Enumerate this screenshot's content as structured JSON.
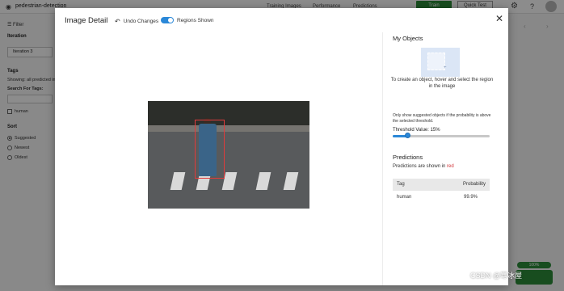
{
  "app": {
    "project_title": "pedestrian-detection",
    "nav": [
      "Training Images",
      "Performance",
      "Predictions"
    ],
    "train_label": "Train",
    "quick_test_label": "Quick Test",
    "accent_color": "#2c8c3a"
  },
  "sidebar": {
    "filter_label": "Filter",
    "iteration_heading": "Iteration",
    "iteration_value": "Iteration 3",
    "tags_heading": "Tags",
    "showing_text": "Showing: all predicted in",
    "search_tags_label": "Search For Tags:",
    "tag_item": "human",
    "sort_heading": "Sort",
    "sort_options": [
      "Suggested",
      "Newest",
      "Oldest"
    ],
    "sort_selected": "Suggested"
  },
  "progress": {
    "value": 1.0,
    "label": "100%"
  },
  "modal": {
    "title": "Image Detail",
    "undo_label": "Undo Changes",
    "regions_toggle_label": "Regions Shown",
    "regions_shown": true,
    "image_alt": "pedestrian crossing street",
    "my_objects": {
      "heading": "My Objects",
      "hint": "To create an object, hover and select the region in the image"
    },
    "threshold": {
      "note": "Only show suggested objects if the probability is above the selected threshold.",
      "label": "Threshold Value: 15%",
      "value": 0.15
    },
    "predictions": {
      "heading": "Predictions",
      "note_prefix": "Predictions are shown in",
      "note_color_word": "red",
      "columns": [
        "Tag",
        "Probability"
      ],
      "rows": [
        {
          "tag": "human",
          "probability": "99.9%"
        }
      ]
    }
  },
  "watermark": "CSDN @寒冰屋",
  "colors": {
    "toggle": "#2b88d8",
    "prediction_box": "#e03b3b",
    "overlay": "rgba(0,0,0,0.45)"
  }
}
